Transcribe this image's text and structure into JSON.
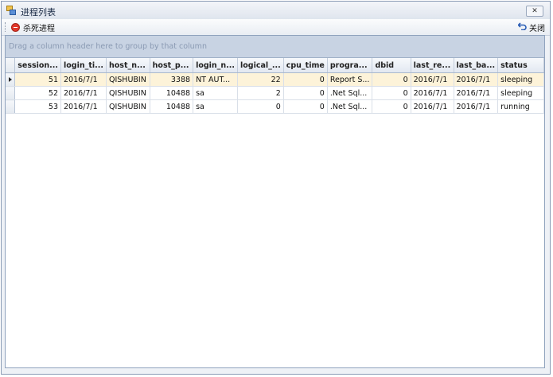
{
  "window": {
    "title": "进程列表",
    "close_glyph": "✕"
  },
  "toolbar": {
    "kill_label": "杀死进程",
    "close_label": "关闭"
  },
  "grid": {
    "group_hint": "Drag a column header here to group by that column",
    "columns": [
      "session...",
      "login_ti...",
      "host_n...",
      "host_p...",
      "login_n...",
      "logical_...",
      "cpu_time",
      "progra...",
      "dbid",
      "last_re...",
      "last_ba...",
      "status"
    ],
    "rows": [
      [
        "51",
        "2016/7/1",
        "QISHUBIN",
        "3388",
        "NT AUT...",
        "22",
        "0",
        "Report S...",
        "0",
        "2016/7/1",
        "2016/7/1",
        "sleeping"
      ],
      [
        "52",
        "2016/7/1",
        "QISHUBIN",
        "10488",
        "sa",
        "2",
        "0",
        ".Net Sql...",
        "0",
        "2016/7/1",
        "2016/7/1",
        "sleeping"
      ],
      [
        "53",
        "2016/7/1",
        "QISHUBIN",
        "10488",
        "sa",
        "0",
        "0",
        ".Net Sql...",
        "0",
        "2016/7/1",
        "2016/7/1",
        "running"
      ]
    ],
    "selected_row": 0
  }
}
